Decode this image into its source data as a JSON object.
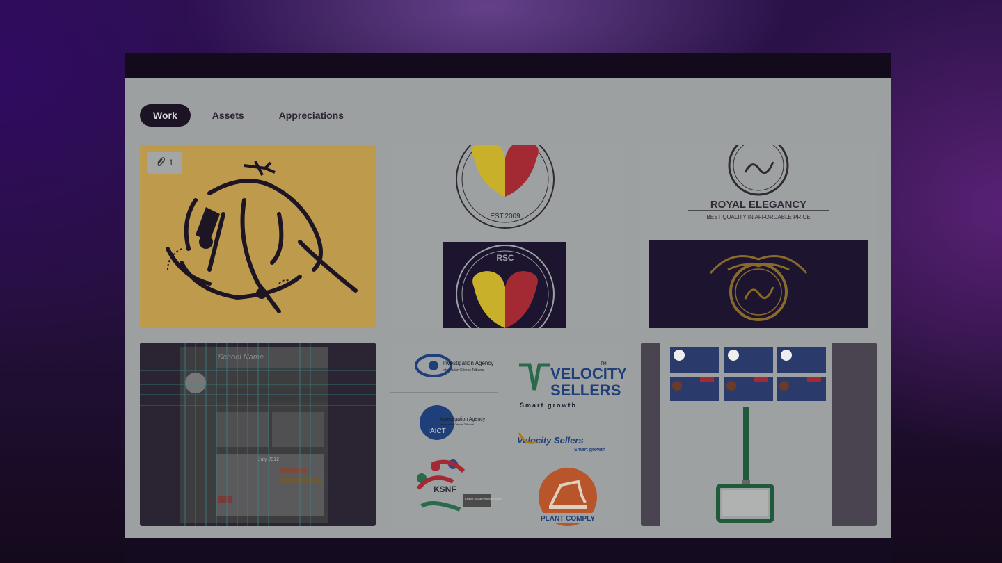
{
  "tabs": [
    {
      "label": "Work",
      "active": true
    },
    {
      "label": "Assets",
      "active": false
    },
    {
      "label": "Appreciations",
      "active": false
    }
  ],
  "projects": [
    {
      "attachment_count": "1"
    },
    {
      "top_text": "EST.2009",
      "bottom_text": "RSC"
    },
    {
      "brand": "ROYAL ELEGANCY",
      "tagline": "BEST QUALITY IN AFFORDABLE PRICE"
    },
    {
      "school_name": "School Name",
      "calendar_month": "July 2012"
    },
    {
      "investigation_agency": "Investigation Agency",
      "agency_sub": "Internation Crimes Tribunal",
      "iaict": "IAICT",
      "velocity": "VELOCITY",
      "sellers": "SELLERS",
      "tm": "TM",
      "smart_growth": "Smart growth",
      "velocity_sellers_script": "Velocity Sellers",
      "smart_growth_2": "Smart growth",
      "ksnf": "KSNF",
      "ksnf_sub": "Kalkott Social Network Forum",
      "plant_comply": "PLANT COMPLY"
    },
    {}
  ],
  "colors": {
    "window_bg": "#9da0a0",
    "topbar": "#130a1c",
    "active_tab": "#1c1425",
    "card_yellow": "#bd9a4c",
    "navy": "#1d1530",
    "heart_yellow": "#c9b02a",
    "heart_red": "#a32a33",
    "gold": "#8a6a2a"
  }
}
